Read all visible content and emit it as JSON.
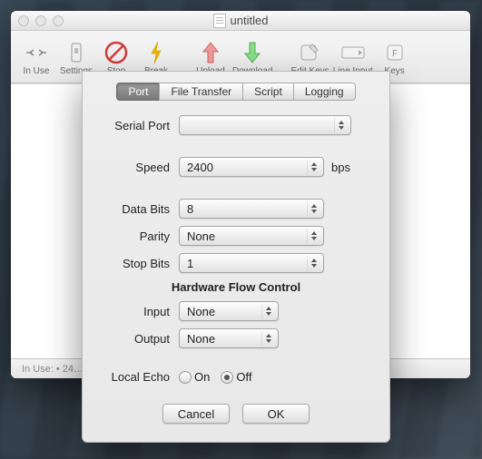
{
  "window": {
    "title": "untitled"
  },
  "toolbar": {
    "items": [
      {
        "label": "In Use"
      },
      {
        "label": "Settings"
      },
      {
        "label": "Stop"
      },
      {
        "label": "Break"
      },
      {
        "label": "Upload"
      },
      {
        "label": "Download"
      },
      {
        "label": "Edit Keys"
      },
      {
        "label": "Line Input"
      },
      {
        "label": "Keys"
      }
    ]
  },
  "statusbar": {
    "text": "In Use:  • 24…"
  },
  "sheet": {
    "tabs": [
      "Port",
      "File Transfer",
      "Script",
      "Logging"
    ],
    "active_tab": "Port",
    "labels": {
      "serial_port": "Serial Port",
      "speed": "Speed",
      "speed_unit": "bps",
      "data_bits": "Data Bits",
      "parity": "Parity",
      "stop_bits": "Stop Bits",
      "flow_heading": "Hardware Flow Control",
      "input": "Input",
      "output": "Output",
      "local_echo": "Local Echo",
      "on": "On",
      "off": "Off"
    },
    "values": {
      "serial_port": "",
      "speed": "2400",
      "data_bits": "8",
      "parity": "None",
      "stop_bits": "1",
      "input": "None",
      "output": "None",
      "local_echo": "Off"
    },
    "buttons": {
      "cancel": "Cancel",
      "ok": "OK"
    }
  },
  "colors": {
    "stop_red": "#d23a3a",
    "break_yellow": "#f2b200",
    "upload_red": "#e05a5a",
    "download_green": "#4fc24f"
  }
}
